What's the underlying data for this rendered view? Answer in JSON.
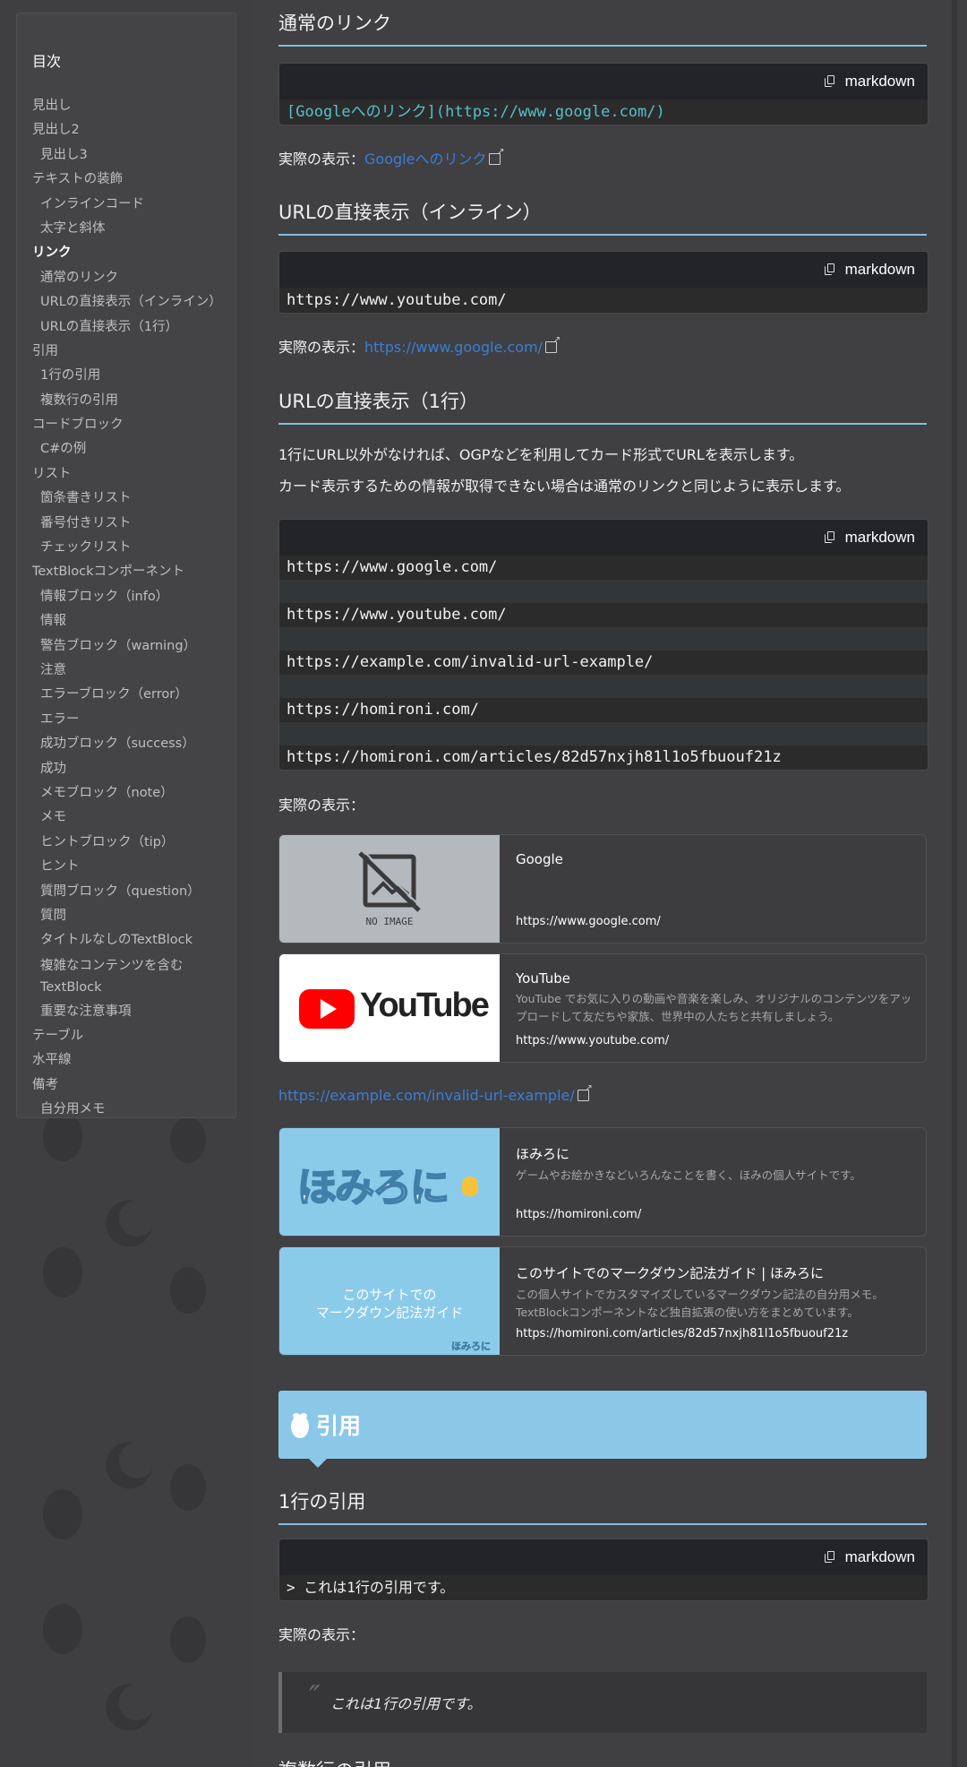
{
  "toc": {
    "title": "目次",
    "items": [
      {
        "label": "見出し",
        "level": 1
      },
      {
        "label": "見出し2",
        "level": 1
      },
      {
        "label": "見出し3",
        "level": 2
      },
      {
        "label": "テキストの装飾",
        "level": 1
      },
      {
        "label": "インラインコード",
        "level": 2
      },
      {
        "label": "太字と斜体",
        "level": 2
      },
      {
        "label": "リンク",
        "level": 1,
        "active": true
      },
      {
        "label": "通常のリンク",
        "level": 2
      },
      {
        "label": "URLの直接表示（インライン）",
        "level": 2
      },
      {
        "label": "URLの直接表示（1行）",
        "level": 2
      },
      {
        "label": "引用",
        "level": 1
      },
      {
        "label": "1行の引用",
        "level": 2
      },
      {
        "label": "複数行の引用",
        "level": 2
      },
      {
        "label": "コードブロック",
        "level": 1
      },
      {
        "label": "C#の例",
        "level": 2
      },
      {
        "label": "リスト",
        "level": 1
      },
      {
        "label": "箇条書きリスト",
        "level": 2
      },
      {
        "label": "番号付きリスト",
        "level": 2
      },
      {
        "label": "チェックリスト",
        "level": 2
      },
      {
        "label": "TextBlockコンポーネント",
        "level": 1
      },
      {
        "label": "情報ブロック（info）",
        "level": 2
      },
      {
        "label": "情報",
        "level": 2
      },
      {
        "label": "警告ブロック（warning）",
        "level": 2
      },
      {
        "label": "注意",
        "level": 2
      },
      {
        "label": "エラーブロック（error）",
        "level": 2
      },
      {
        "label": "エラー",
        "level": 2
      },
      {
        "label": "成功ブロック（success）",
        "level": 2
      },
      {
        "label": "成功",
        "level": 2
      },
      {
        "label": "メモブロック（note）",
        "level": 2
      },
      {
        "label": "メモ",
        "level": 2
      },
      {
        "label": "ヒントブロック（tip）",
        "level": 2
      },
      {
        "label": "ヒント",
        "level": 2
      },
      {
        "label": "質問ブロック（question）",
        "level": 2
      },
      {
        "label": "質問",
        "level": 2
      },
      {
        "label": "タイトルなしのTextBlock",
        "level": 2
      },
      {
        "label": "複雑なコンテンツを含むTextBlock",
        "level": 2,
        "wrap": true
      },
      {
        "label": "重要な注意事項",
        "level": 2
      },
      {
        "label": "テーブル",
        "level": 1
      },
      {
        "label": "水平線",
        "level": 1
      },
      {
        "label": "備考",
        "level": 1
      },
      {
        "label": "自分用メモ",
        "level": 2
      }
    ]
  },
  "code_lang": "markdown",
  "shown_label": "実際の表示：",
  "sec_normal": {
    "heading": "通常のリンク",
    "code": "[Googleへのリンク](https://www.google.com/)",
    "link_text": "Googleへのリンク"
  },
  "sec_inline": {
    "heading": "URLの直接表示（インライン）",
    "code": "https://www.youtube.com/",
    "link_text": "https://www.google.com/"
  },
  "sec_oneline": {
    "heading": "URLの直接表示（1行）",
    "para1": "1行にURL以外がなければ、OGPなどを利用してカード形式でURLを表示します。",
    "para2": "カード表示するための情報が取得できない場合は通常のリンクと同じように表示します。",
    "code_lines": [
      "https://www.google.com/",
      "",
      "https://www.youtube.com/",
      "",
      "https://example.com/invalid-url-example/",
      "",
      "https://homironi.com/",
      "",
      "https://homironi.com/articles/82d57nxjh81l1o5fbuouf21z"
    ],
    "shown_label": "実際の表示：",
    "cards": [
      {
        "title": "Google",
        "desc": "",
        "url": "https://www.google.com/",
        "thumb_text": "NO IMAGE"
      },
      {
        "title": "YouTube",
        "desc": "YouTube でお気に入りの動画や音楽を楽しみ、オリジナルのコンテンツをアップロードして友だちや家族、世界中の人たちと共有しましょう。",
        "url": "https://www.youtube.com/",
        "thumb_text": "YouTube"
      }
    ],
    "plain_link": "https://example.com/invalid-url-example/",
    "cards2": [
      {
        "title": "ほみろに",
        "desc": "ゲームやお絵かきなどいろんなことを書く、ほみの個人サイトです。",
        "url": "https://homironi.com/",
        "thumb_text": "ほみろに"
      },
      {
        "title": "このサイトでのマークダウン記法ガイド | ほみろに",
        "desc": "この個人サイトでカスタマイズしているマークダウン記法の自分用メモ。TextBlockコンポーネントなど独自拡張の使い方をまとめています。",
        "url": "https://homironi.com/articles/82d57nxjh81l1o5fbuouf21z",
        "thumb_line1": "このサイトでの",
        "thumb_line2": "マークダウン記法ガイド",
        "thumb_mark": "ほみろに"
      }
    ]
  },
  "sec_quote": {
    "band_label": "引用",
    "heading": "1行の引用",
    "code": ">  これは1行の引用です。",
    "shown_label": "実際の表示：",
    "quote_text": "これは1行の引用です。",
    "next_heading": "複数行の引用"
  },
  "colors": {
    "accent": "#7fbfdd",
    "band": "#8bc8e8",
    "link": "#3a7fd6",
    "page_bg": "#3f3e41"
  }
}
